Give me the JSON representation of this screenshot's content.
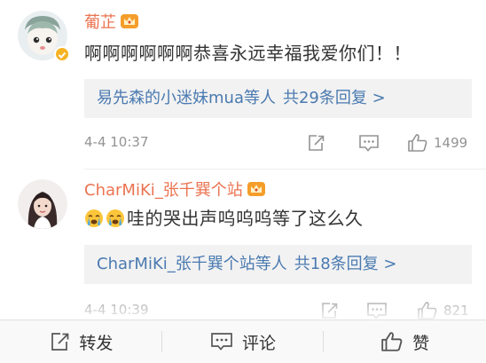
{
  "comments": [
    {
      "username": "葡芷",
      "text": "啊啊啊啊啊啊恭喜永远幸福我爱你们！！",
      "reply_summary": {
        "names": "易先森的小迷妹mua等人",
        "count_text": "共29条回复 >"
      },
      "time": "4-4 10:37",
      "likes": "1499"
    },
    {
      "username": "CharMiKi_张千巽个站",
      "text": "哇的哭出声呜呜呜等了这么久",
      "reply_summary": {
        "names": "CharMiKi_张千巽个站等人",
        "count_text": "共18条回复 >"
      },
      "time": "4-4 10:39",
      "likes": "821"
    }
  ],
  "toolbar": {
    "repost": "转发",
    "comment": "评论",
    "like": "赞"
  },
  "colors": {
    "username": "#eb7350",
    "link": "#4a7ab0",
    "text": "#333333",
    "meta": "#939393",
    "reply_bg": "#f2f2f2"
  },
  "icons": {
    "crown": "crown-badge-icon",
    "verified": "verified-badge-icon",
    "repost": "repost-icon",
    "comment": "comment-icon",
    "like": "thumbs-up-icon",
    "crying": "crying-emoji-icon"
  }
}
